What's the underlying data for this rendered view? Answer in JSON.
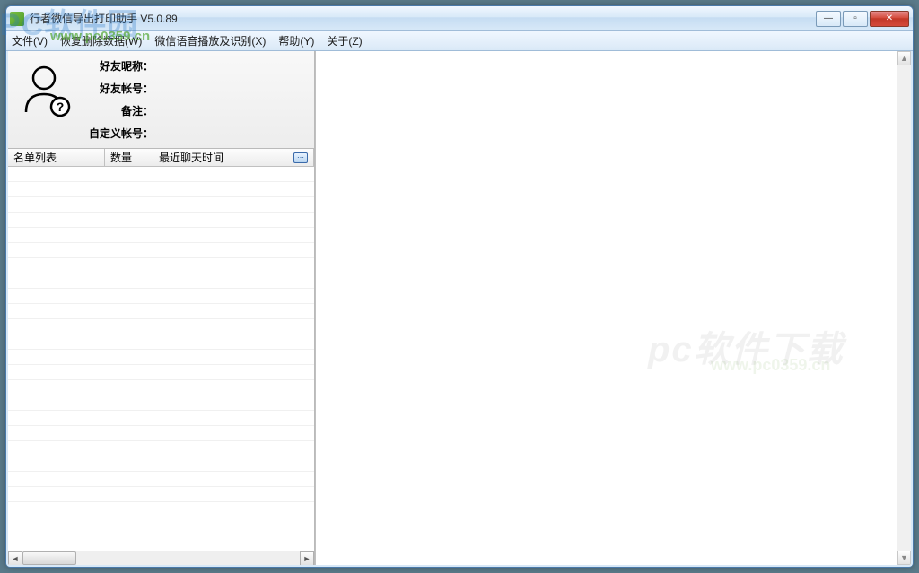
{
  "window": {
    "title": "行者微信导出打印助手  V5.0.89"
  },
  "menu": {
    "file": "文件(V)",
    "recover": "恢复删除数据(W)",
    "voice": "微信语音播放及识别(X)",
    "help": "帮助(Y)",
    "about": "关于(Z)"
  },
  "info": {
    "nickname_label": "好友昵称：",
    "nickname_value": "",
    "account_label": "好友帐号：",
    "account_value": "",
    "remark_label": "备注：",
    "remark_value": "",
    "custom_label": "自定义帐号：",
    "custom_value": ""
  },
  "columns": {
    "name_list": "名单列表",
    "count": "数量",
    "last_chat": "最近聊天时间"
  },
  "watermarks": {
    "wm1": "PC软件园",
    "wm2": "www.pc0359.cn",
    "wm3": "pc软件下载",
    "wm4": "www.pc0359.cn"
  },
  "win_controls": {
    "minimize": "—",
    "maximize": "▫",
    "close": "✕"
  }
}
